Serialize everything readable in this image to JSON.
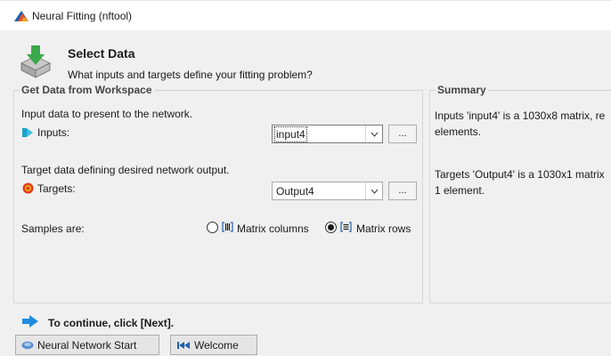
{
  "window": {
    "title": "Neural Fitting (nftool)"
  },
  "header": {
    "title": "Select Data",
    "subtitle": "What inputs and targets define your fitting problem?"
  },
  "workspace": {
    "legend": "Get Data from Workspace",
    "input_caption": "Input data to present to the network.",
    "inputs_label": "Inputs:",
    "inputs_value": "input4",
    "target_caption": "Target data defining desired network output.",
    "targets_label": "Targets:",
    "targets_value": "Output4",
    "browse_label": "...",
    "samples_label": "Samples are:",
    "option_columns": "Matrix columns",
    "option_rows": "Matrix rows",
    "selected_option": "rows"
  },
  "summary": {
    "legend": "Summary",
    "inputs_line1": "Inputs 'input4' is a 1030x8 matrix, re",
    "inputs_line2": "elements.",
    "targets_line1": "Targets 'Output4' is a 1030x1 matrix",
    "targets_line2": "1 element."
  },
  "footer": {
    "hint": "To continue, click [Next].",
    "nn_start_label": "Neural Network Start",
    "welcome_label": "Welcome"
  },
  "colors": {
    "accent_blue": "#1e8ce0",
    "icon_red": "#e03a1e",
    "icon_orange": "#f2a21b",
    "icon_green": "#3aa84a"
  }
}
